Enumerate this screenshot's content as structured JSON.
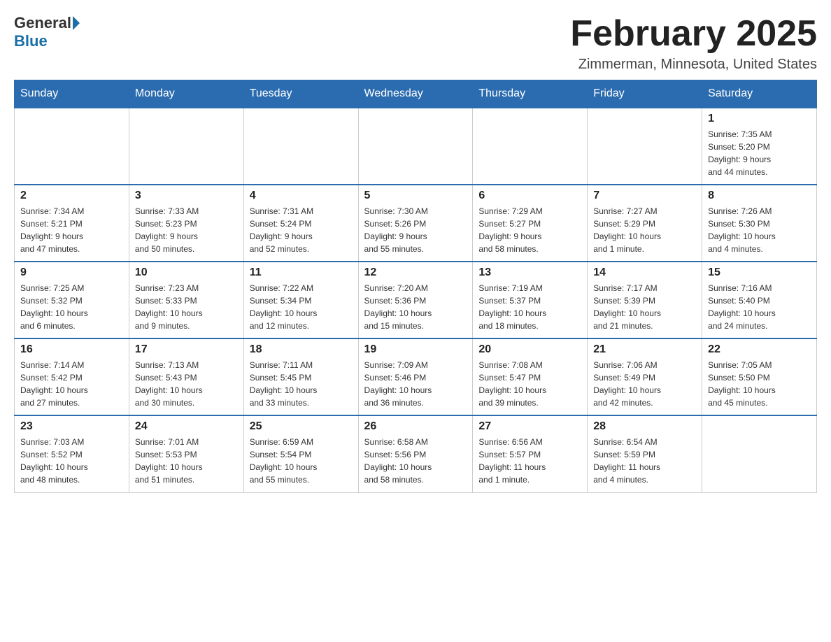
{
  "logo": {
    "general": "General",
    "blue": "Blue"
  },
  "title": "February 2025",
  "location": "Zimmerman, Minnesota, United States",
  "days_of_week": [
    "Sunday",
    "Monday",
    "Tuesday",
    "Wednesday",
    "Thursday",
    "Friday",
    "Saturday"
  ],
  "weeks": [
    [
      {
        "day": "",
        "info": ""
      },
      {
        "day": "",
        "info": ""
      },
      {
        "day": "",
        "info": ""
      },
      {
        "day": "",
        "info": ""
      },
      {
        "day": "",
        "info": ""
      },
      {
        "day": "",
        "info": ""
      },
      {
        "day": "1",
        "info": "Sunrise: 7:35 AM\nSunset: 5:20 PM\nDaylight: 9 hours\nand 44 minutes."
      }
    ],
    [
      {
        "day": "2",
        "info": "Sunrise: 7:34 AM\nSunset: 5:21 PM\nDaylight: 9 hours\nand 47 minutes."
      },
      {
        "day": "3",
        "info": "Sunrise: 7:33 AM\nSunset: 5:23 PM\nDaylight: 9 hours\nand 50 minutes."
      },
      {
        "day": "4",
        "info": "Sunrise: 7:31 AM\nSunset: 5:24 PM\nDaylight: 9 hours\nand 52 minutes."
      },
      {
        "day": "5",
        "info": "Sunrise: 7:30 AM\nSunset: 5:26 PM\nDaylight: 9 hours\nand 55 minutes."
      },
      {
        "day": "6",
        "info": "Sunrise: 7:29 AM\nSunset: 5:27 PM\nDaylight: 9 hours\nand 58 minutes."
      },
      {
        "day": "7",
        "info": "Sunrise: 7:27 AM\nSunset: 5:29 PM\nDaylight: 10 hours\nand 1 minute."
      },
      {
        "day": "8",
        "info": "Sunrise: 7:26 AM\nSunset: 5:30 PM\nDaylight: 10 hours\nand 4 minutes."
      }
    ],
    [
      {
        "day": "9",
        "info": "Sunrise: 7:25 AM\nSunset: 5:32 PM\nDaylight: 10 hours\nand 6 minutes."
      },
      {
        "day": "10",
        "info": "Sunrise: 7:23 AM\nSunset: 5:33 PM\nDaylight: 10 hours\nand 9 minutes."
      },
      {
        "day": "11",
        "info": "Sunrise: 7:22 AM\nSunset: 5:34 PM\nDaylight: 10 hours\nand 12 minutes."
      },
      {
        "day": "12",
        "info": "Sunrise: 7:20 AM\nSunset: 5:36 PM\nDaylight: 10 hours\nand 15 minutes."
      },
      {
        "day": "13",
        "info": "Sunrise: 7:19 AM\nSunset: 5:37 PM\nDaylight: 10 hours\nand 18 minutes."
      },
      {
        "day": "14",
        "info": "Sunrise: 7:17 AM\nSunset: 5:39 PM\nDaylight: 10 hours\nand 21 minutes."
      },
      {
        "day": "15",
        "info": "Sunrise: 7:16 AM\nSunset: 5:40 PM\nDaylight: 10 hours\nand 24 minutes."
      }
    ],
    [
      {
        "day": "16",
        "info": "Sunrise: 7:14 AM\nSunset: 5:42 PM\nDaylight: 10 hours\nand 27 minutes."
      },
      {
        "day": "17",
        "info": "Sunrise: 7:13 AM\nSunset: 5:43 PM\nDaylight: 10 hours\nand 30 minutes."
      },
      {
        "day": "18",
        "info": "Sunrise: 7:11 AM\nSunset: 5:45 PM\nDaylight: 10 hours\nand 33 minutes."
      },
      {
        "day": "19",
        "info": "Sunrise: 7:09 AM\nSunset: 5:46 PM\nDaylight: 10 hours\nand 36 minutes."
      },
      {
        "day": "20",
        "info": "Sunrise: 7:08 AM\nSunset: 5:47 PM\nDaylight: 10 hours\nand 39 minutes."
      },
      {
        "day": "21",
        "info": "Sunrise: 7:06 AM\nSunset: 5:49 PM\nDaylight: 10 hours\nand 42 minutes."
      },
      {
        "day": "22",
        "info": "Sunrise: 7:05 AM\nSunset: 5:50 PM\nDaylight: 10 hours\nand 45 minutes."
      }
    ],
    [
      {
        "day": "23",
        "info": "Sunrise: 7:03 AM\nSunset: 5:52 PM\nDaylight: 10 hours\nand 48 minutes."
      },
      {
        "day": "24",
        "info": "Sunrise: 7:01 AM\nSunset: 5:53 PM\nDaylight: 10 hours\nand 51 minutes."
      },
      {
        "day": "25",
        "info": "Sunrise: 6:59 AM\nSunset: 5:54 PM\nDaylight: 10 hours\nand 55 minutes."
      },
      {
        "day": "26",
        "info": "Sunrise: 6:58 AM\nSunset: 5:56 PM\nDaylight: 10 hours\nand 58 minutes."
      },
      {
        "day": "27",
        "info": "Sunrise: 6:56 AM\nSunset: 5:57 PM\nDaylight: 11 hours\nand 1 minute."
      },
      {
        "day": "28",
        "info": "Sunrise: 6:54 AM\nSunset: 5:59 PM\nDaylight: 11 hours\nand 4 minutes."
      },
      {
        "day": "",
        "info": ""
      }
    ]
  ]
}
